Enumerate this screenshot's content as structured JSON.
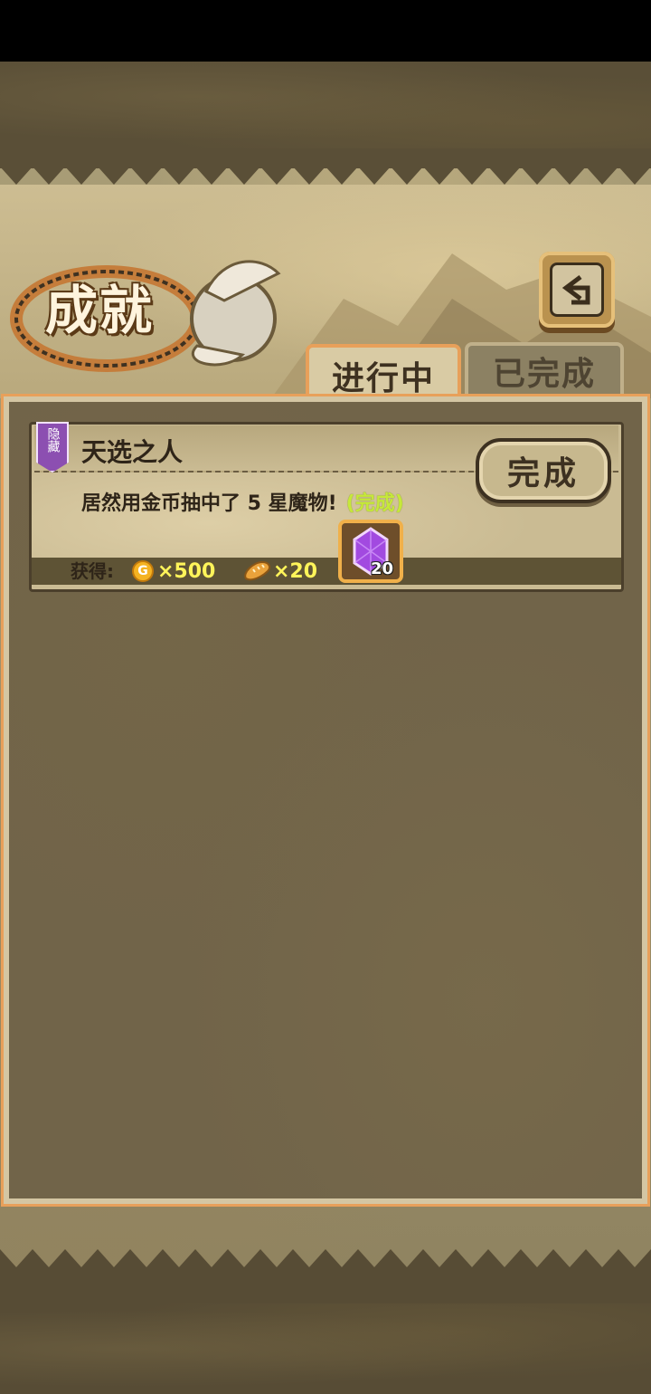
{
  "header": {
    "title": "成就",
    "back_icon": "return-arrow-icon"
  },
  "tabs": [
    {
      "label": "进行中",
      "active": true
    },
    {
      "label": "已完成",
      "active": false
    }
  ],
  "achievements": [
    {
      "badge": "隐藏",
      "title": "天选之人",
      "description": "居然用金币抽中了 5 星魔物!",
      "status": "(完成)",
      "button_label": "完成",
      "reward_label": "获得:",
      "rewards": [
        {
          "icon": "gold-coin-icon",
          "icon_text": "G",
          "amount": "×500"
        },
        {
          "icon": "bread-icon",
          "amount": "×20"
        },
        {
          "icon": "purple-gem-icon",
          "amount": "20"
        }
      ]
    }
  ],
  "colors": {
    "accent": "#e8a05a",
    "status_complete": "#c6e83a",
    "reward_amount": "#fff45a",
    "badge_hidden": "#8c4fb1"
  }
}
